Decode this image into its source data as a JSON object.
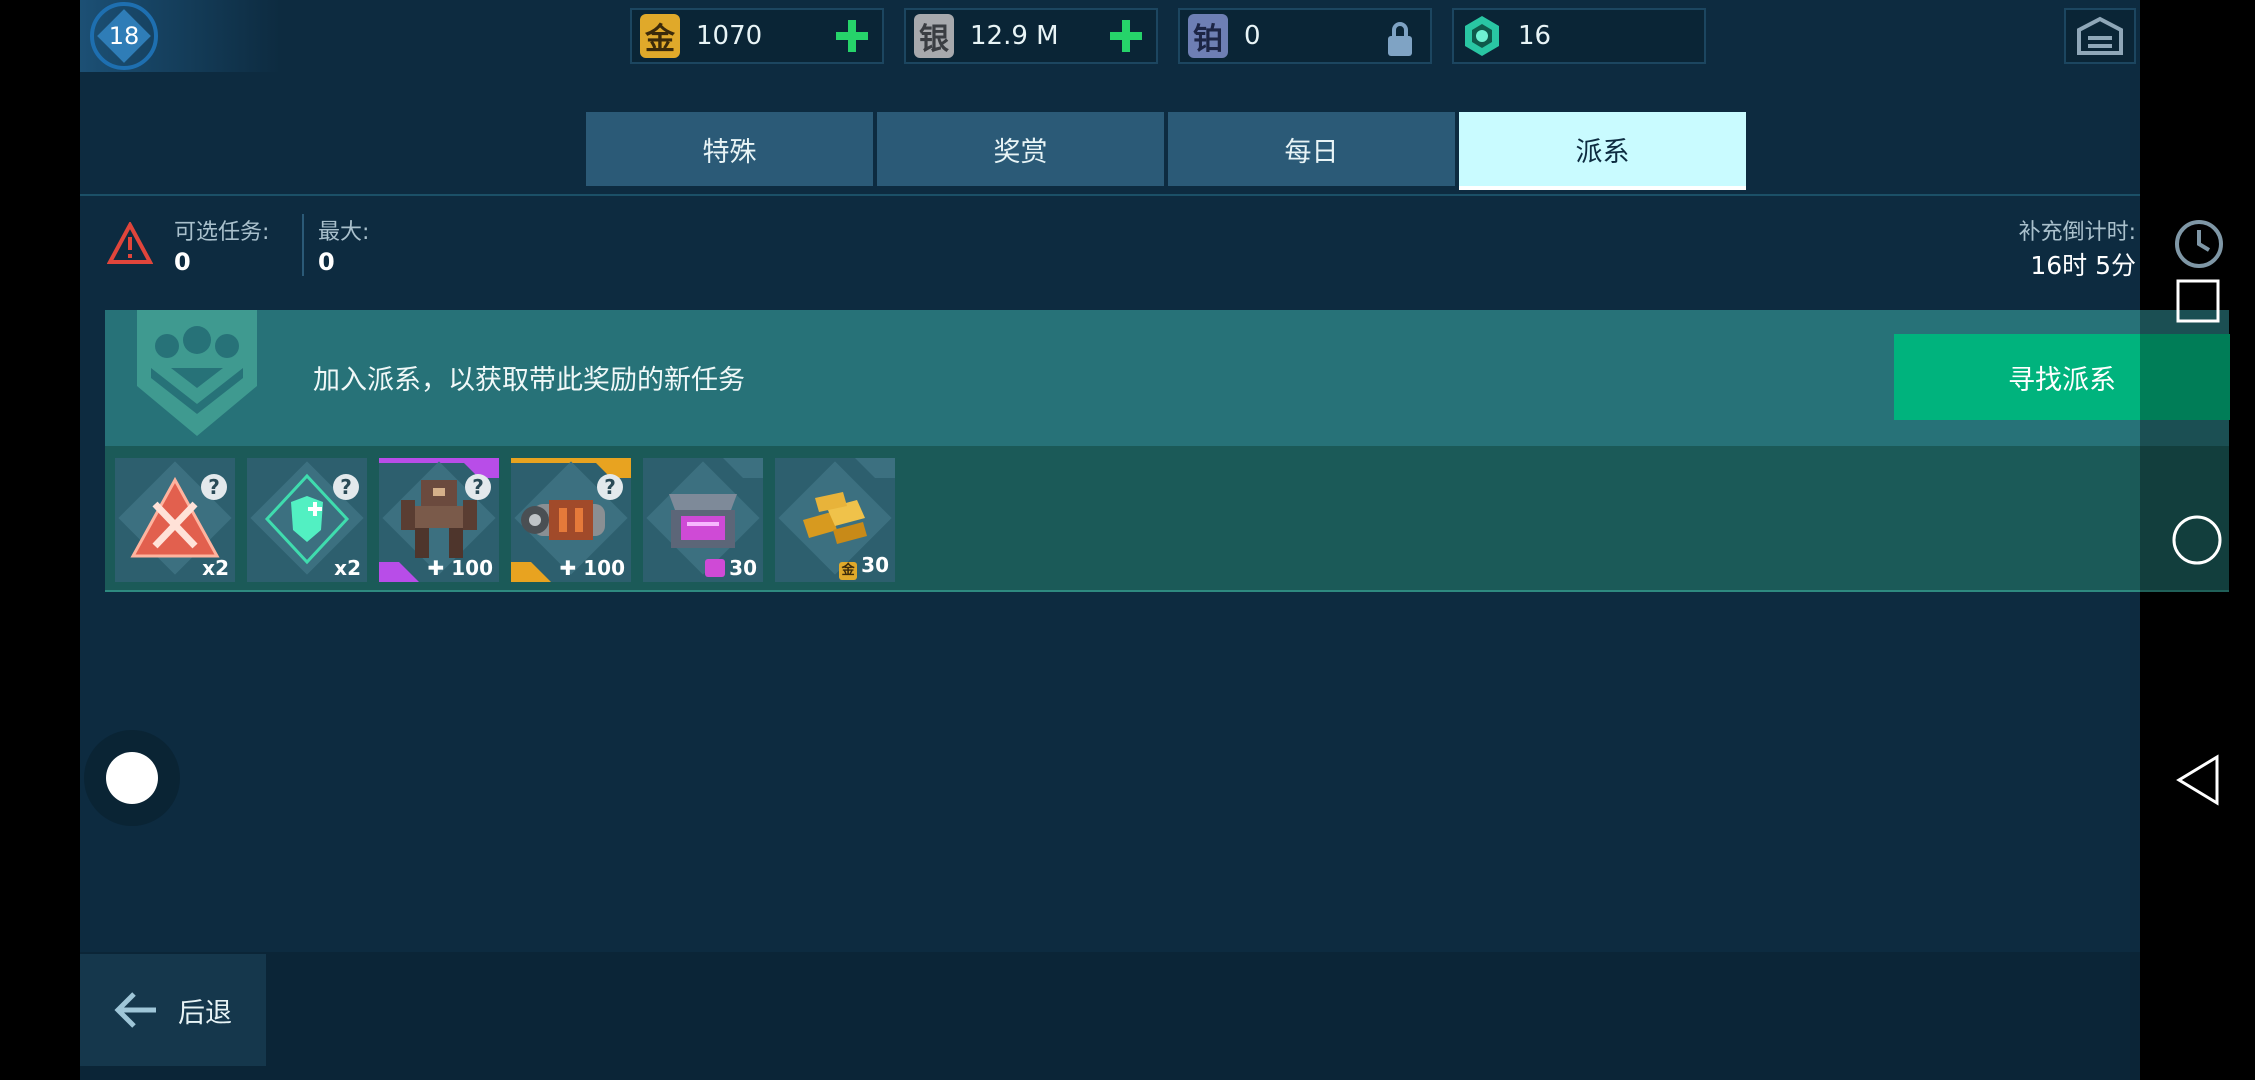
{
  "player": {
    "level": "18"
  },
  "currencies": [
    {
      "name": "gold",
      "glyph": "金",
      "value": "1070",
      "color": "#e0a92a"
    },
    {
      "name": "silver",
      "glyph": "银",
      "value": "12.9 M",
      "color": "#a7a9ad"
    },
    {
      "name": "platinum",
      "glyph": "铂",
      "value": "0",
      "color": "#6e7fb4"
    },
    {
      "name": "gem",
      "value": "16",
      "color": "#29c6a3"
    }
  ],
  "tabs": [
    "特殊",
    "奖赏",
    "每日",
    "派系"
  ],
  "active_tab": "派系",
  "stats": {
    "available_label": "可选任务:",
    "available_value": "0",
    "max_label": "最大:",
    "max_value": "0",
    "refill_label": "补充倒计时:",
    "refill_value": "16时 5分"
  },
  "banner": {
    "text": "加入派系，以获取带此奖励的新任务",
    "button": "寻找派系"
  },
  "rewards": [
    {
      "kind": "booster-attack",
      "count": "x2"
    },
    {
      "kind": "booster-shield",
      "count": "x2"
    },
    {
      "kind": "robot-parts",
      "count": "100",
      "rarity_color": "#b84de8"
    },
    {
      "kind": "weapon-parts",
      "count": "100",
      "rarity_color": "#e8a320"
    },
    {
      "kind": "key-chest",
      "count": "30"
    },
    {
      "kind": "gold-bars",
      "count": "30",
      "glyph": "金"
    }
  ],
  "bottom": {
    "back_label": "后退"
  },
  "colors": {
    "accent": "#00b37d",
    "active_tab": "#c9fbff",
    "background": "#0d2b40"
  }
}
